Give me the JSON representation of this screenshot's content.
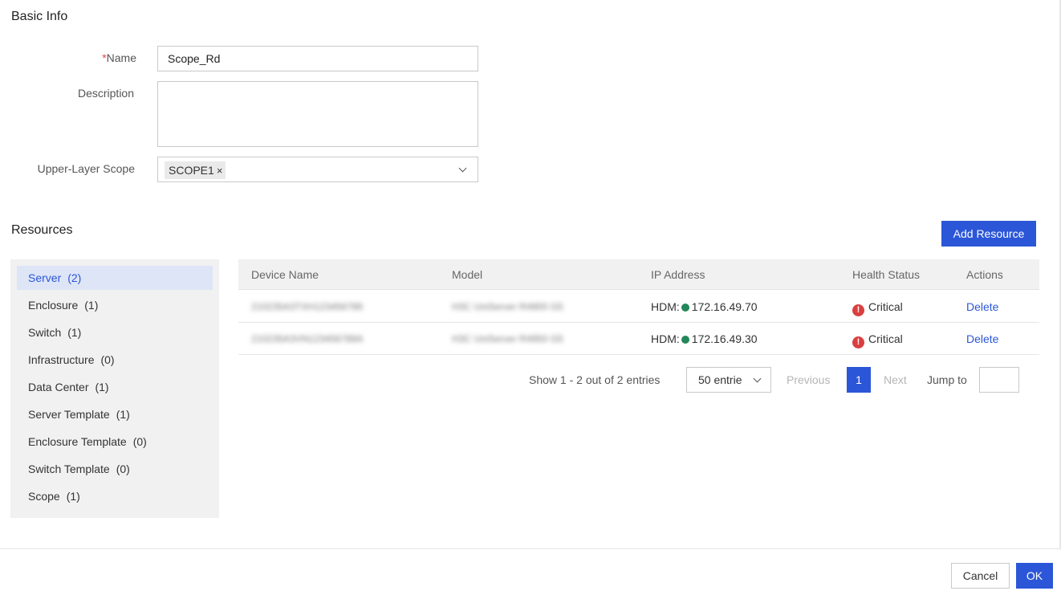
{
  "basic_info": {
    "title": "Basic Info",
    "name_label": "Name",
    "name_required_mark": "*",
    "name_value": "Scope_Rd",
    "description_label": "Description",
    "description_value": "",
    "upper_scope_label": "Upper-Layer Scope",
    "upper_scope_tag": "SCOPE1",
    "tag_remove_glyph": "×"
  },
  "resources": {
    "title": "Resources",
    "add_button": "Add Resource",
    "categories": [
      {
        "label": "Server",
        "count": "(2)"
      },
      {
        "label": "Enclosure",
        "count": "(1)"
      },
      {
        "label": "Switch",
        "count": "(1)"
      },
      {
        "label": "Infrastructure",
        "count": "(0)"
      },
      {
        "label": "Data Center",
        "count": "(1)"
      },
      {
        "label": "Server Template",
        "count": "(1)"
      },
      {
        "label": "Enclosure Template",
        "count": "(0)"
      },
      {
        "label": "Switch Template",
        "count": "(0)"
      },
      {
        "label": "Scope",
        "count": "(1)"
      }
    ],
    "columns": [
      "Device Name",
      "Model",
      "IP Address",
      "Health Status",
      "Actions"
    ],
    "rows": [
      {
        "device_name": "210235A3TXH123456789",
        "model": "H3C UniServer R4900 G5",
        "ip_prefix": "HDM:",
        "ip": "172.16.49.70",
        "health": "Critical",
        "action": "Delete"
      },
      {
        "device_name": "210235A3VN123456789A",
        "model": "H3C UniServer R4950 G5",
        "ip_prefix": "HDM:",
        "ip": "172.16.49.30",
        "health": "Critical",
        "action": "Delete"
      }
    ],
    "pagination": {
      "summary": "Show 1 - 2 out of 2 entries",
      "page_size": "50 entrie",
      "previous": "Previous",
      "current_page": "1",
      "next": "Next",
      "jump_label": "Jump to",
      "jump_value": ""
    }
  },
  "footer": {
    "cancel": "Cancel",
    "ok": "OK"
  },
  "colors": {
    "primary": "#2b56d7",
    "status_ok": "#23875a",
    "status_critical": "#d93f3f"
  },
  "icons": {
    "dropdown": "chevron-down-icon",
    "tag_remove": "close-icon",
    "health_critical": "exclamation-circle-icon",
    "ip_status": "status-dot-icon"
  }
}
